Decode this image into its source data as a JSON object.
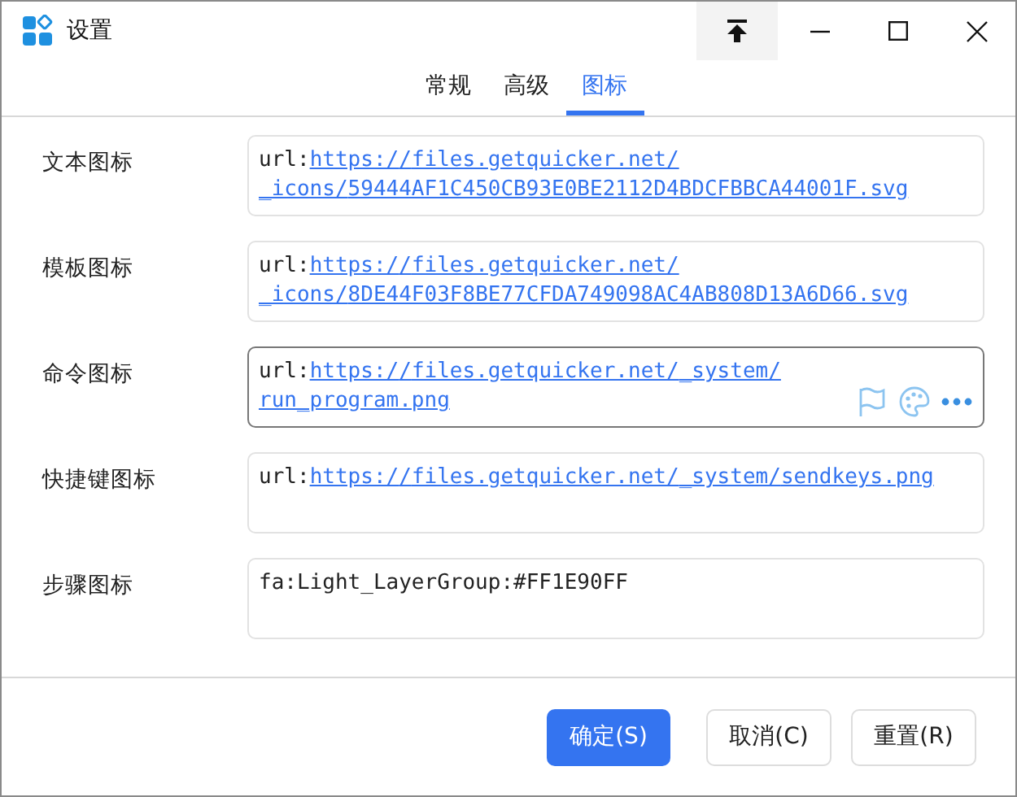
{
  "window": {
    "title": "设置"
  },
  "tabs": [
    {
      "label": "常规",
      "selected": false
    },
    {
      "label": "高级",
      "selected": false
    },
    {
      "label": "图标",
      "selected": true
    }
  ],
  "fields": [
    {
      "label": "文本图标",
      "prefix": "url:",
      "link": "https://files.getquicker.net/_icons/59444AF1C450CB93E0BE2112D4BDCFBBCA44001F.svg",
      "focused": false
    },
    {
      "label": "模板图标",
      "prefix": "url:",
      "link": "https://files.getquicker.net/_icons/8DE44F03F8BE77CFDA749098AC4AB808D13A6D66.svg",
      "focused": false
    },
    {
      "label": "命令图标",
      "prefix": "url:",
      "link": "https://files.getquicker.net/_system/run_program.png",
      "focused": true
    },
    {
      "label": "快捷键图标",
      "prefix": "url:",
      "link": "https://files.getquicker.net/_system/sendkeys.png",
      "focused": false
    },
    {
      "label": "步骤图标",
      "prefix": "fa:Light_LayerGroup:#FF1E90FF",
      "focused": false
    }
  ],
  "buttons": [
    {
      "label": "确定(S)",
      "kind": "primary"
    },
    {
      "label": "取消(C)",
      "kind": "normal"
    },
    {
      "label": "重置(R)",
      "kind": "normal"
    }
  ]
}
